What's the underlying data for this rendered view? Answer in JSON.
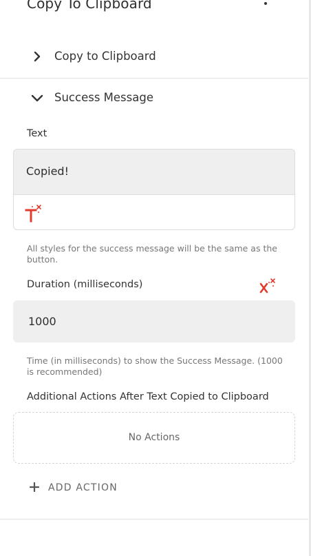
{
  "header": {
    "title": "Copy To Clipboard"
  },
  "sections": [
    {
      "label": "Copy to Clipboard",
      "expanded": false
    },
    {
      "label": "Success Message",
      "expanded": true
    }
  ],
  "success_message": {
    "text_label": "Text",
    "text_value": "Copied!",
    "text_hint": "All styles for the success message will be the same as the button.",
    "duration_label": "Duration (milliseconds)",
    "duration_value": "1000",
    "duration_hint": "Time (in milliseconds) to show the Success Message. (1000 is recommended)",
    "actions_label": "Additional Actions After Text Copied to Clipboard",
    "no_actions": "No Actions",
    "add_action_label": "ADD ACTION"
  },
  "colors": {
    "accent": "#e23b2e",
    "field_bg": "#efefef",
    "border": "#dcdcdc"
  }
}
